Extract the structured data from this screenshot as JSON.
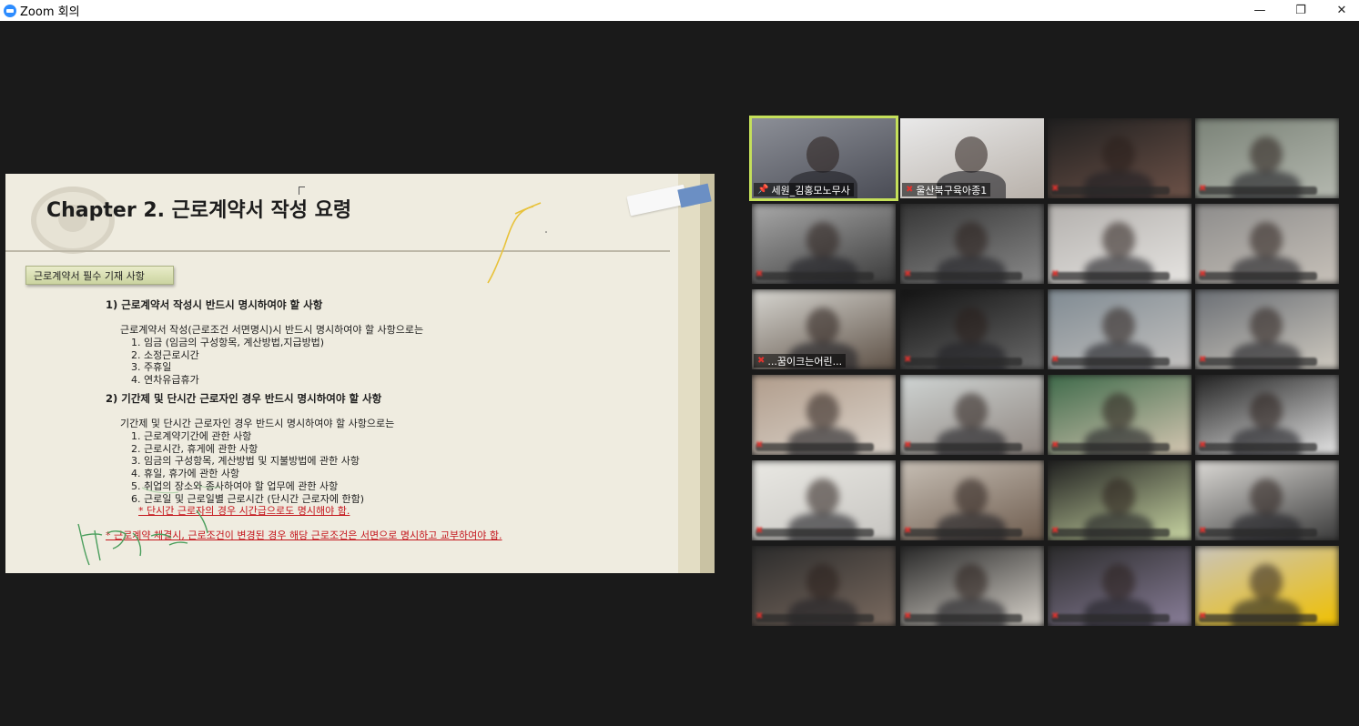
{
  "window": {
    "title": "Zoom 회의",
    "controls": {
      "minimize": "—",
      "maximize": "❐",
      "close": "✕"
    }
  },
  "slide": {
    "title": "Chapter 2. 근로계약서 작성 요령",
    "label": "근로계약서 필수 기재 사항",
    "section1": {
      "heading": "1) 근로계약서 작성시 반드시 명시하여야 할 사항",
      "intro": "근로계약서 작성(근로조건 서면명시)시 반드시 명시하여야 할 사항으로는",
      "items": [
        "1. 임금 (임금의 구성항목, 계산방법,지급방법)",
        "2. 소정근로시간",
        "3. 주휴일",
        "4. 연차유급휴가"
      ]
    },
    "section2": {
      "heading": "2) 기간제 및 단시간 근로자인 경우 반드시 명시하여야 할 사항",
      "intro": "기간제 및 단시간 근로자인 경우 반드시 명시하여야 할 사항으로는",
      "items": [
        "1. 근로계약기간에 관한 사항",
        "2. 근로시간, 휴게에 관한 사항",
        "3. 임금의 구성항목, 계산방법 및 지불방법에 관한 사항",
        "4. 휴일, 휴가에 관한 사항",
        "5. 취업의 장소와 종사하여야 할 업무에 관한 사항",
        "6. 근로일 및 근로일별 근로시간 (단시간 근로자에 한함)"
      ],
      "note": "* 단시간 근로자의 경우 시간급으로도 명시해야 함."
    },
    "footer_note": "* 근로계약 체결시, 근로조건이 변경된 경우 해당 근로조건은 서면으로 명시하고 교부하여야 함.",
    "handwriting": "휴가(사무실)"
  },
  "gallery": {
    "tiles": [
      {
        "name": "세원_김홍모노무사",
        "icon": "pin-icon",
        "active": true,
        "visible_name": true
      },
      {
        "name": "울산북구육아종1",
        "icon": "mic-muted-icon",
        "active": false,
        "visible_name": true
      },
      {
        "name": "",
        "icon": "mic-muted-icon",
        "active": false,
        "visible_name": false
      },
      {
        "name": "",
        "icon": "mic-muted-icon",
        "active": false,
        "visible_name": false
      },
      {
        "name": "",
        "icon": "mic-muted-icon",
        "active": false,
        "visible_name": false
      },
      {
        "name": "",
        "icon": "mic-muted-icon",
        "active": false,
        "visible_name": false
      },
      {
        "name": "",
        "icon": "mic-muted-icon",
        "active": false,
        "visible_name": false
      },
      {
        "name": "",
        "icon": "mic-muted-icon",
        "active": false,
        "visible_name": false
      },
      {
        "name": "...꿈이크는어린...",
        "icon": "mic-muted-icon",
        "active": false,
        "visible_name": true
      },
      {
        "name": "",
        "icon": "mic-muted-icon",
        "active": false,
        "visible_name": false
      },
      {
        "name": "",
        "icon": "mic-muted-icon",
        "active": false,
        "visible_name": false
      },
      {
        "name": "",
        "icon": "mic-muted-icon",
        "active": false,
        "visible_name": false
      },
      {
        "name": "",
        "icon": "mic-muted-icon",
        "active": false,
        "visible_name": false
      },
      {
        "name": "",
        "icon": "mic-muted-icon",
        "active": false,
        "visible_name": false
      },
      {
        "name": "",
        "icon": "mic-muted-icon",
        "active": false,
        "visible_name": false
      },
      {
        "name": "",
        "icon": "mic-muted-icon",
        "active": false,
        "visible_name": false
      },
      {
        "name": "",
        "icon": "mic-muted-icon",
        "active": false,
        "visible_name": false
      },
      {
        "name": "",
        "icon": "mic-muted-icon",
        "active": false,
        "visible_name": false
      },
      {
        "name": "",
        "icon": "mic-muted-icon",
        "active": false,
        "visible_name": false
      },
      {
        "name": "",
        "icon": "mic-muted-icon",
        "active": false,
        "visible_name": false
      },
      {
        "name": "",
        "icon": "mic-muted-icon",
        "active": false,
        "visible_name": false
      },
      {
        "name": "",
        "icon": "mic-muted-icon",
        "active": false,
        "visible_name": false
      },
      {
        "name": "",
        "icon": "mic-muted-icon",
        "active": false,
        "visible_name": false
      },
      {
        "name": "",
        "icon": "mic-muted-icon",
        "active": false,
        "visible_name": false
      }
    ]
  }
}
